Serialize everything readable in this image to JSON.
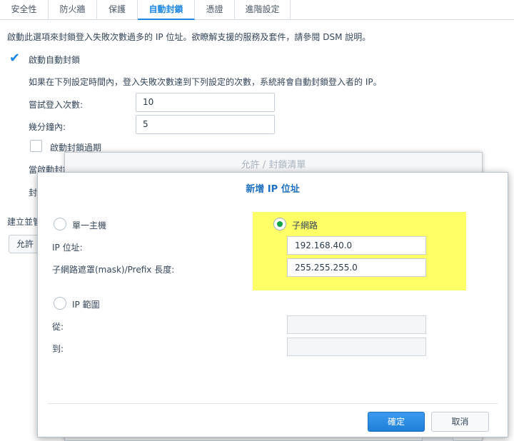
{
  "tabs": [
    "安全性",
    "防火牆",
    "保護",
    "自動封鎖",
    "憑證",
    "進階設定"
  ],
  "active_tab": "自動封鎖",
  "base": {
    "description": "啟動此選項來封鎖登入失敗次數過多的 IP 位址。欲瞭解支援的服務及套件，請參閱 DSM 說明。",
    "enable_autoblock_label": "啟動自動封鎖",
    "enable_autoblock_checked": true,
    "rule_text": "如果在下列設定時間內，登入失敗次數達到下列設定的次數，系統將會自動封鎖登入者的 IP。",
    "attempts_label": "嘗試登入次數:",
    "attempts_value": "10",
    "minutes_label": "幾分鐘內:",
    "minutes_value": "5",
    "enable_expiry_label": "啟動封鎖過期",
    "enable_expiry_checked": false,
    "partial_label_1": "當啟動封鎖",
    "partial_label_2": "封",
    "partial_label_3": "建立並管",
    "partial_button": "允許"
  },
  "list_dialog": {
    "title": "允許 / 封鎖清單"
  },
  "add_ip_dialog": {
    "title": "新增 IP 位址",
    "single_host_label": "單一主機",
    "subnet_label": "子網路",
    "selected": "subnet",
    "ip_address_label": "IP 位址:",
    "ip_address_value": "192.168.40.0",
    "mask_label": "子網路遮罩(mask)/Prefix 長度:",
    "mask_value": "255.255.255.0",
    "ip_range_label": "IP 範圍",
    "from_label": "從:",
    "to_label": "到:",
    "from_value": "",
    "to_value": "",
    "ok_label": "確定",
    "cancel_label": "取消"
  },
  "colors": {
    "accent": "#1d87e4",
    "highlight": "#ffff66",
    "radio_selected": "#10a34a"
  }
}
